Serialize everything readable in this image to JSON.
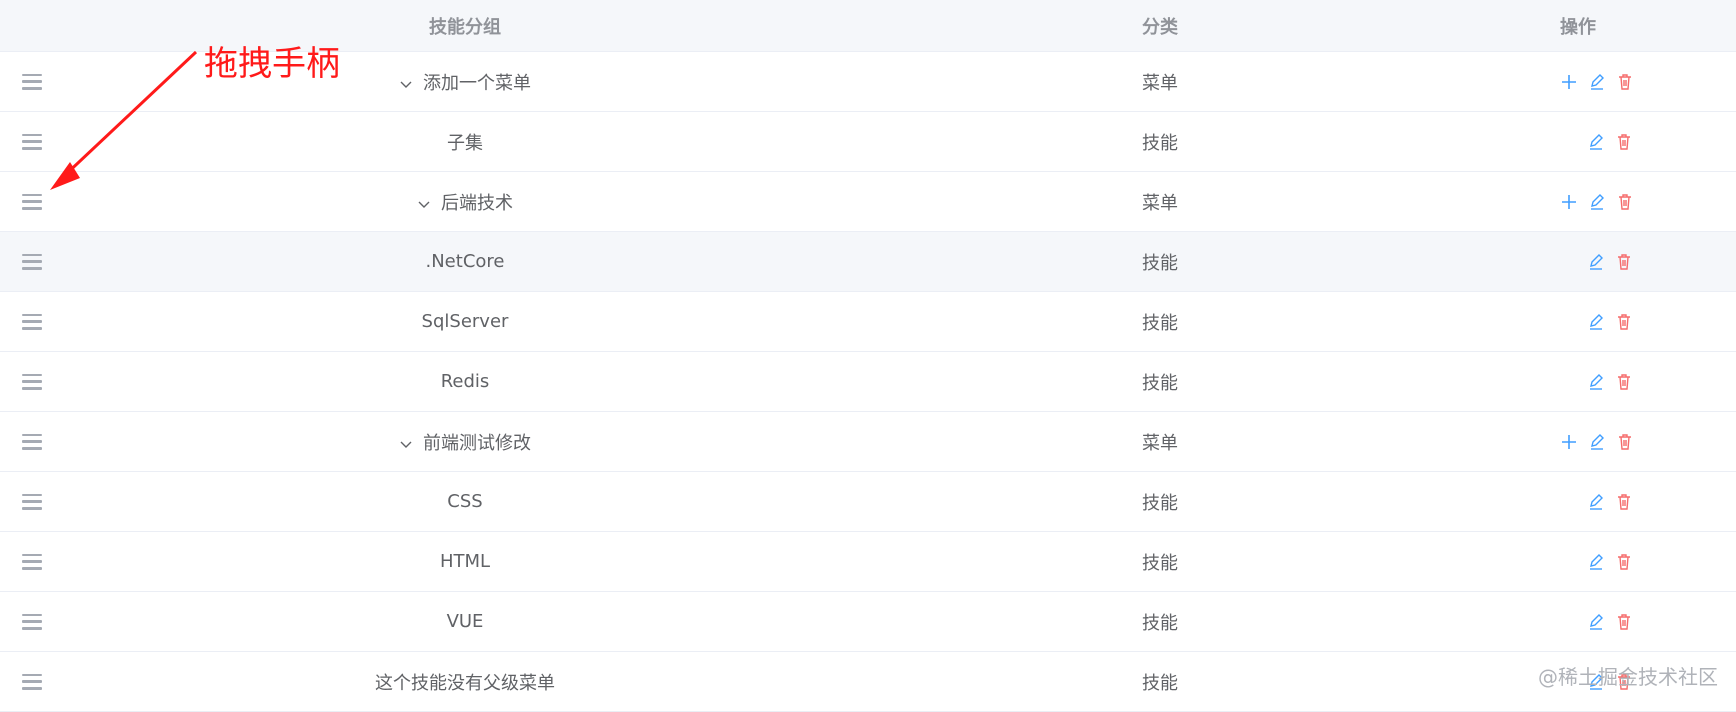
{
  "header": {
    "col_name": "技能分组",
    "col_type": "分类",
    "col_ops": "操作"
  },
  "annotation": {
    "text": "拖拽手柄"
  },
  "watermark": {
    "text": "@稀土掘金技术社区"
  },
  "rows": [
    {
      "name": "添加一个菜单",
      "type": "菜单",
      "expandable": true,
      "add": true
    },
    {
      "name": "子集",
      "type": "技能",
      "expandable": false,
      "add": false
    },
    {
      "name": "后端技术",
      "type": "菜单",
      "expandable": true,
      "add": true
    },
    {
      "name": ".NetCore",
      "type": "技能",
      "expandable": false,
      "add": false,
      "hover": true
    },
    {
      "name": "SqlServer",
      "type": "技能",
      "expandable": false,
      "add": false
    },
    {
      "name": "Redis",
      "type": "技能",
      "expandable": false,
      "add": false
    },
    {
      "name": "前端测试修改",
      "type": "菜单",
      "expandable": true,
      "add": true
    },
    {
      "name": "CSS",
      "type": "技能",
      "expandable": false,
      "add": false
    },
    {
      "name": "HTML",
      "type": "技能",
      "expandable": false,
      "add": false
    },
    {
      "name": "VUE",
      "type": "技能",
      "expandable": false,
      "add": false
    },
    {
      "name": "这个技能没有父级菜单",
      "type": "技能",
      "expandable": false,
      "add": false
    }
  ],
  "colors": {
    "primary": "#409eff",
    "danger": "#f56c6c",
    "annotation": "#ff1a1a"
  },
  "icons": {
    "handle": "drag-handle-icon",
    "expand": "chevron-down-icon",
    "add": "plus-icon",
    "edit": "edit-icon",
    "delete": "delete-icon"
  }
}
